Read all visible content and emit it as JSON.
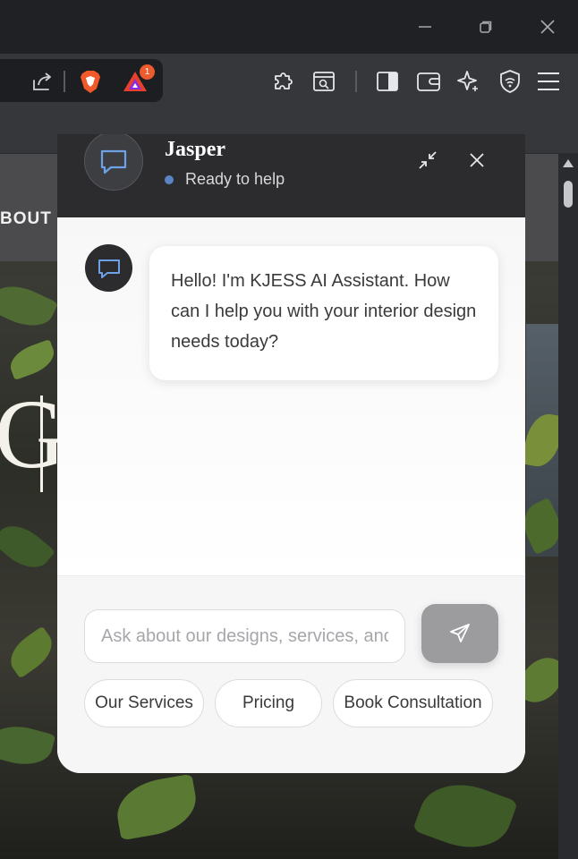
{
  "chat": {
    "agent_name": "Jasper",
    "status_text": "Ready to help",
    "messages": [
      {
        "sender": "assistant",
        "text": "Hello! I'm KJESS AI Assistant. How can I help you with your interior design needs today?"
      }
    ],
    "input_placeholder": "Ask about our designs, services, and more...",
    "quick_replies": [
      "Our Services",
      "Pricing",
      "Book Consultation"
    ]
  },
  "website": {
    "nav_visible_text": "BOUT",
    "hero_visible_text": "G"
  },
  "browser": {
    "extension_badge_count": "1",
    "icons": [
      "minimize-icon",
      "restore-icon",
      "close-icon",
      "share-icon",
      "brave-shields-icon",
      "brave-rewards-icon",
      "extensions-icon",
      "reader-mode-icon",
      "sidebar-icon",
      "wallet-icon",
      "leo-ai-icon",
      "vpn-icon",
      "menu-icon"
    ]
  },
  "colors": {
    "chat_header": "#2c2c2e",
    "status_dot": "#5b84c4",
    "send_button": "#9c9c9e",
    "badge": "#ec5b2e"
  }
}
